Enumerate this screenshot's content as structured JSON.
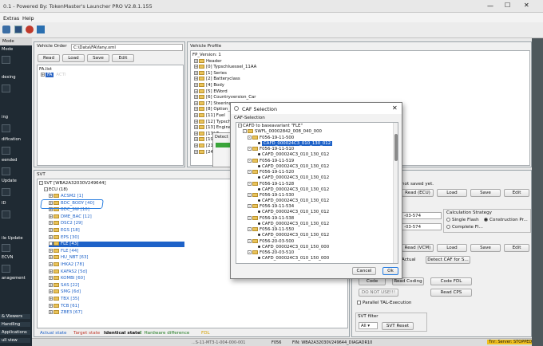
{
  "window": {
    "title": "0.1 - Powered By: TokenMaster's Launcher PRO V2.8.1.155"
  },
  "menu": [
    "Extras",
    "Help"
  ],
  "sidebar": {
    "header": "Mode",
    "items": [
      "Mode",
      "dexing",
      "ing",
      "dification",
      "eended",
      "Update",
      "ID",
      "ile Update",
      "ECVN",
      "anagement"
    ],
    "bottom": [
      "& Viewers",
      "Handling",
      "Applications",
      "ull view"
    ]
  },
  "vehicle_order": {
    "title": "Vehicle Order",
    "path": "C:\\Data\\FA\\fany.xml",
    "buttons": [
      "Read",
      "Load",
      "Save",
      "Edit"
    ],
    "tree": [
      "FA.list",
      "FA"
    ],
    "tree_hint": "ACTI"
  },
  "vehicle_profile": {
    "title": "Vehicle Profile",
    "items": [
      "FP_Version: 1",
      "Header",
      "[0] Typschluessel_11AA",
      "[1] Series",
      "[2] Batteryclass",
      "[4] Body",
      "[5] EWord",
      "[6] Countryversion_Car",
      "[7] Steering",
      "[8] Option_...",
      "[11] Fuel",
      "[12] Typsch...",
      "[13] Engine",
      "[17] Trans...",
      "[19] ...",
      "[21] ...",
      "[24] ..."
    ],
    "detect_label": "Detect"
  },
  "svt": {
    "title": "SVT",
    "root": "SVT [WBA2A32030V249644]",
    "ecu_group": "ECU (18)",
    "ecus": [
      "ACSM2 [1]",
      "BDC_BODY [40]",
      "BDC_SW [10]",
      "DME_BAC [12]",
      "DSC2 [29]",
      "EGS [18]",
      "EPS [30]",
      "FLE [43]",
      "FLE [44]",
      "HU_NBT [63]",
      "IHKA2 [78]",
      "KAFAS2 [5d]",
      "KOMBI [60]",
      "SAS [22]",
      "SMG [6d]",
      "TBX [35]",
      "TCB [61]",
      "ZBE3 [67]"
    ],
    "selected_index": 7
  },
  "status_legend": [
    "Actual state",
    "Target state",
    "Identical state",
    "Hardware difference",
    "FDL"
  ],
  "status_colors": {
    "actual": "#1e62c8",
    "target": "#c0392b",
    "identical": "#111111",
    "hardware": "#1f7a1f",
    "fdl": "#d4a000"
  },
  "right_panel": {
    "not_saved": "not saved yet.",
    "buttons_row1": [
      "Read (ECU)",
      "Load",
      "Save",
      "Edit"
    ],
    "combo_value": "-03-574",
    "calculation_strategy": {
      "label": "Calculation Strategy",
      "options": [
        "Single Flash",
        "Construction Pr...",
        "Complete Fl..."
      ],
      "selected": 1
    },
    "buttons_row2": [
      "Read (VCM)",
      "Load",
      "Save",
      "Edit"
    ],
    "actual_label": "Actual",
    "detect_caf": "Detect CAF for S...",
    "coding_buttons": [
      "Code",
      "Read Coding",
      "Code FDL"
    ],
    "do_not_use": "DO NOT USE!!!",
    "read_cps": "Read CPS",
    "parallel_tal": "Parallel TAL-Execution",
    "svt_filter": {
      "label": "SVT filter",
      "value": "All",
      "reset": "SVT Reset"
    }
  },
  "caf_dialog": {
    "title": "CAF Selection",
    "group_label": "CAF-Selection",
    "header_text": "CAFD to baseavariant \"FLE\"",
    "swfl": "SWFL_00002842_008_040_000",
    "entries": [
      {
        "folder": "F056-19-11-500",
        "file": "CAFD_000024C3_010_130_012",
        "selected": true
      },
      {
        "folder": "F056-19-11-510",
        "file": "CAFD_000024C3_010_130_012",
        "selected": false
      },
      {
        "folder": "F056-19-11-519",
        "file": "CAFD_000024C3_010_130_012",
        "selected": false
      },
      {
        "folder": "F056-19-11-520",
        "file": "CAFD_000024C3_010_130_012",
        "selected": false
      },
      {
        "folder": "F056-19-11-528",
        "file": "CAFD_000024C3_010_130_012",
        "selected": false
      },
      {
        "folder": "F056-19-11-530",
        "file": "CAFD_000024C3_010_130_012",
        "selected": false
      },
      {
        "folder": "F056-19-11-534",
        "file": "CAFD_000024C3_010_130_012",
        "selected": false
      },
      {
        "folder": "F056-19-11-538",
        "file": "CAFD_000024C3_010_130_012",
        "selected": false
      },
      {
        "folder": "F056-19-11-550",
        "file": "CAFD_000024C3_010_130_012",
        "selected": false
      },
      {
        "folder": "F056-20-03-500",
        "file": "CAFD_000024C3_010_150_000",
        "selected": false
      },
      {
        "folder": "F056-20-03-510",
        "file": "CAFD_000024C3_010_150_000",
        "selected": false
      }
    ],
    "cancel": "Cancel",
    "ok": "Ok"
  },
  "status_bar": {
    "left": "...S-11-MT3-1-004-000-001",
    "mid": "F056",
    "vin": "FIN: WBA2A32030V249644_DIAGADR10",
    "right": "Tnr: Server: STOPPED"
  }
}
